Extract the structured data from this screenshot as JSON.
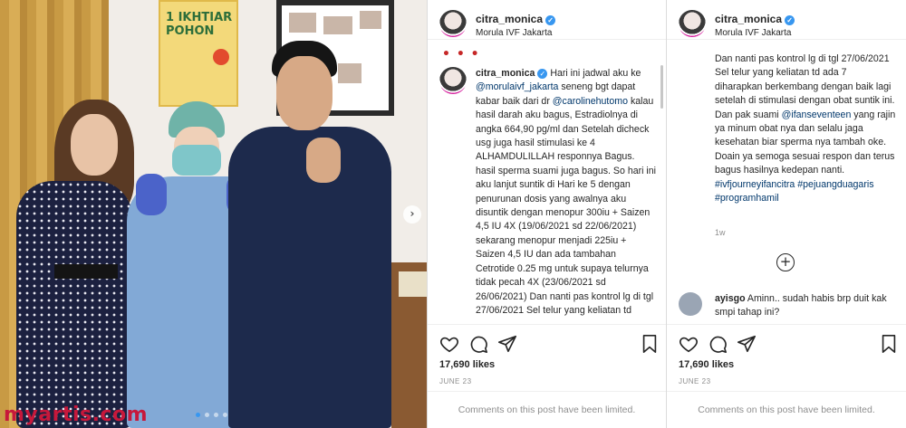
{
  "photo": {
    "poster_text": "1 IKHTIAR POHON",
    "watermark": "myartis.com",
    "carousel": {
      "count": 4,
      "active_index": 0
    }
  },
  "post": {
    "username": "citra_monica",
    "location": "Morula IVF Jakarta",
    "likes": "17,690 likes",
    "date": "JUNE 23",
    "comments_limited": "Comments on this post have been limited.",
    "caption_time": "1w",
    "caption_part1_prefix": "Hari ini jadwal aku ke ",
    "mention_clinic": "@morulaivf_jakarta",
    "caption_part1_mid": " seneng bgt dapat kabar baik dari dr ",
    "mention_doctor": "@carolinehutomo",
    "caption_part1_body": " kalau hasil darah aku bagus, Estradiolnya di angka 664,90 pg/ml dan Setelah dicheck usg juga hasil stimulasi ke 4 ALHAMDULILLAH responnya Bagus. hasil sperma suami juga bagus. So hari ini aku lanjut suntik di Hari ke 5 dengan penurunan dosis yang awalnya aku disuntik dengan menopur 300iu + Saizen 4,5 IU 4X (19/06/2021 sd 22/06/2021) sekarang menopur menjadi 225iu + Saizen 4,5 IU dan ada tambahan Cetrotide 0.25 mg untuk supaya telurnya tidak pecah 4X (23/06/2021 sd 26/06/2021) Dan nanti pas kontrol lg di tgl 27/06/2021 Sel telur yang keliatan td",
    "caption_part2_a": "Dan nanti pas kontrol lg di tgl 27/06/2021 Sel telur yang keliatan td ada 7 diharapkan berkembang dengan baik lagi setelah di stimulasi dengan obat suntik ini. Dan pak suami ",
    "mention_husband": "@ifanseventeen",
    "caption_part2_b": " yang rajin ya minum obat nya dan selalu jaga kesehatan biar sperma nya tambah oke. Doain ya semoga sesuai respon dan terus bagus hasilnya kedepan nanti.",
    "hashtags": "#ivfjourneyifancitra #pejuangduagaris #programhamil",
    "comment": {
      "username": "ayisgo",
      "text": " Aminn.. sudah habis brp duit kak smpi tahap ini?"
    }
  },
  "icons": [
    "verified-badge",
    "heart-icon",
    "comment-icon",
    "share-icon",
    "bookmark-icon",
    "add-comment-icon",
    "next-arrow-icon"
  ],
  "colors": {
    "verified": "#3897f0",
    "mention": "#00376b",
    "watermark": "#c7183b",
    "muted": "#8e8e8e"
  }
}
